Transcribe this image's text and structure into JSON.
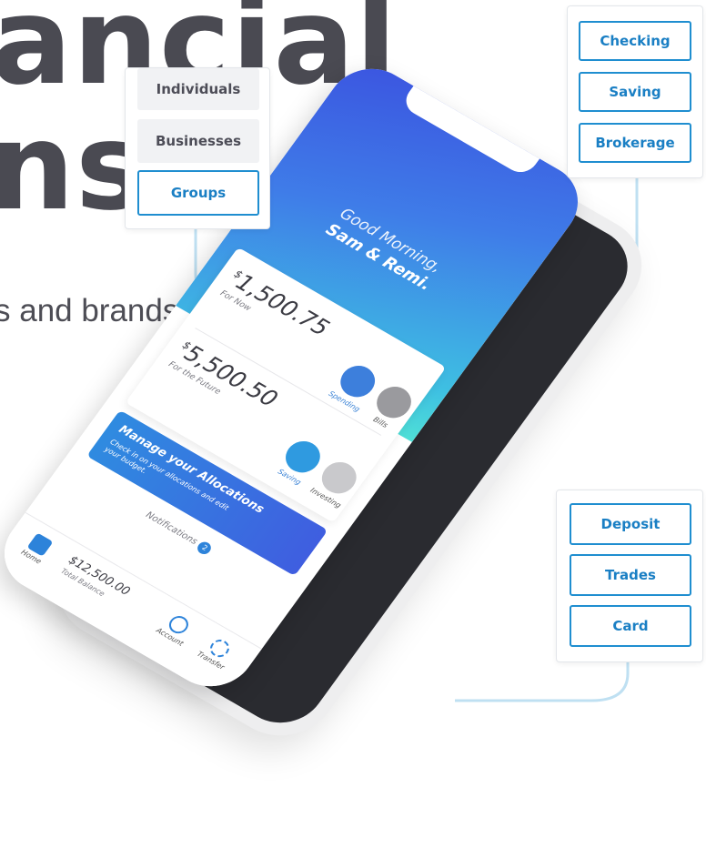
{
  "hero": {
    "line1": "ancial",
    "line2": "ns",
    "subtitle": "s and brands to build across multiple"
  },
  "segment_card": {
    "options": [
      "Individuals",
      "Businesses",
      "Groups"
    ],
    "selected": "Groups"
  },
  "account_card": {
    "options": [
      "Checking",
      "Saving",
      "Brokerage"
    ]
  },
  "action_card": {
    "options": [
      "Deposit",
      "Trades",
      "Card"
    ]
  },
  "phone": {
    "greeting": "Good Morning,",
    "names": "Sam & Remi.",
    "now": {
      "currency": "$",
      "amount": "1,500.75",
      "label": "For Now"
    },
    "future": {
      "currency": "$",
      "amount": "5,500.50",
      "label": "For the Future"
    },
    "categories": [
      {
        "label": "Spending",
        "icon": "spending-icon"
      },
      {
        "label": "Bills",
        "icon": "bills-icon"
      },
      {
        "label": "Saving",
        "icon": "saving-icon"
      },
      {
        "label": "Investing",
        "icon": "investing-icon"
      }
    ],
    "allocations": {
      "title": "Manage your Allocations",
      "subtitle": "Check in on your allocations and edit your budget."
    },
    "notifications": {
      "label": "Notifications",
      "count": "2"
    },
    "balance": {
      "amount": "$12,500.00",
      "label": "Total Balance"
    },
    "tabs": [
      "Home",
      "Account",
      "Transfer"
    ]
  },
  "colors": {
    "accent": "#1f8ed0",
    "headline": "#4a4a52",
    "gradient_start": "#3b54e0",
    "gradient_end": "#4fe0d6"
  }
}
